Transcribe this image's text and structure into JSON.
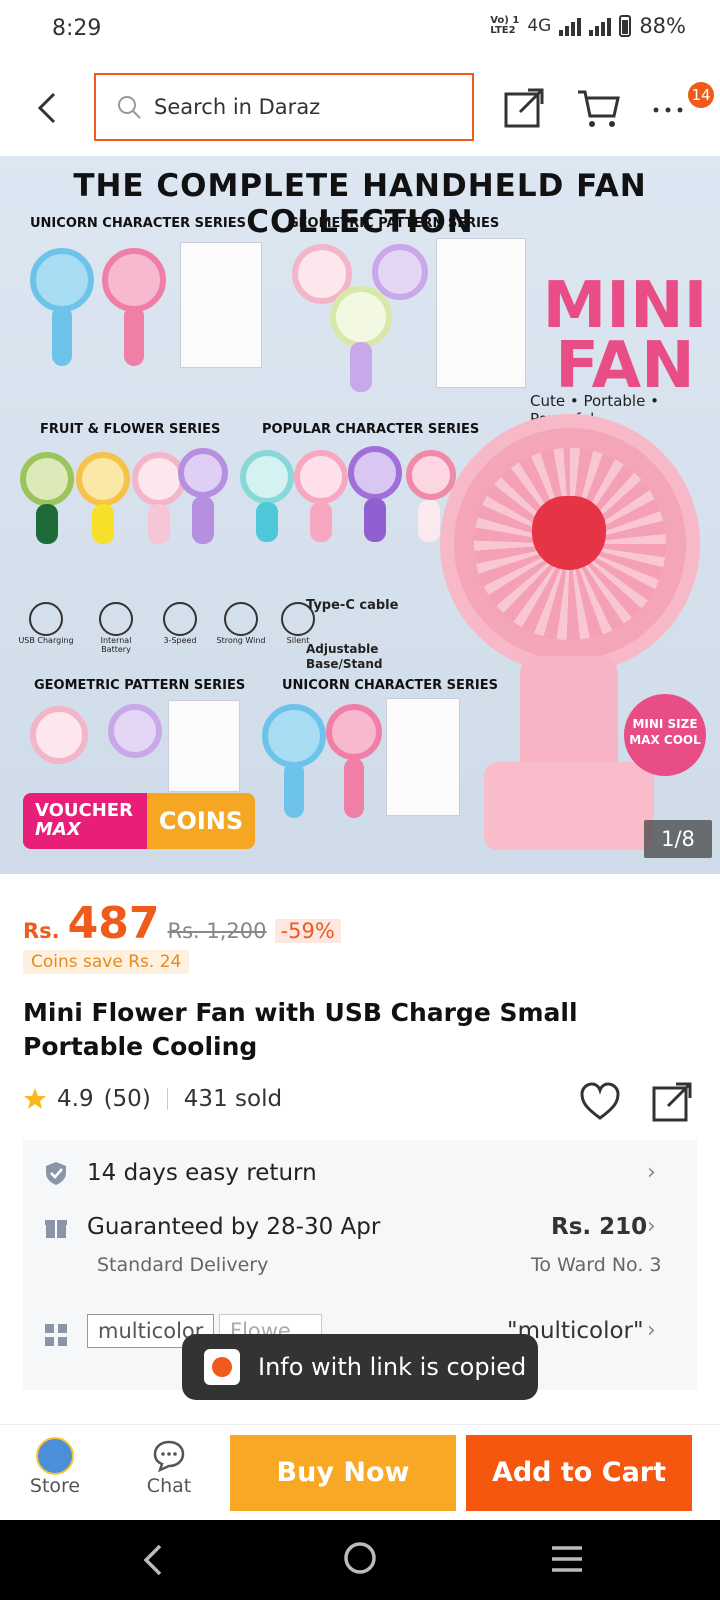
{
  "status_bar": {
    "time": "8:29",
    "network_tag_top": "Vo) 1",
    "network_tag_bottom": "LTE2",
    "network": "4G",
    "battery": "88%"
  },
  "header": {
    "search_placeholder": "Search in Daraz",
    "badge_count": "14"
  },
  "hero": {
    "title": "THE COMPLETE HANDHELD FAN COLLECTION",
    "series": [
      "UNICORN CHARACTER SERIES",
      "GEOMETRIC PATTERN SERIES",
      "FRUIT & FLOWER SERIES",
      "POPULAR CHARACTER SERIES",
      "GEOMETRIC PATTERN SERIES",
      "UNICORN CHARACTER SERIES"
    ],
    "mini_fan_line1": "MINI",
    "mini_fan_line2": "FAN",
    "tagline": "Cute • Portable • Powerful",
    "features": [
      "USB Charging",
      "Internal Battery",
      "3-Speed",
      "Strong Wind",
      "Silent"
    ],
    "type_c": "Type-C cable",
    "adjustable": "Adjustable Base/Stand",
    "mini_size": "MINI SIZE MAX COOL",
    "voucher_line1": "VOUCHER",
    "voucher_line2": "MAX",
    "voucher_coins": "COINS",
    "pager": "1/8"
  },
  "product": {
    "currency": "Rs.",
    "price": "487",
    "old_price": "Rs. 1,200",
    "discount": "-59%",
    "coins_save": "Coins save Rs. 24",
    "name": "Mini Flower Fan with USB Charge Small Portable Cooling",
    "rating": "4.9",
    "reviews": "(50)",
    "sold": "431 sold"
  },
  "info": {
    "return": "14 days easy return",
    "guarantee": "Guaranteed by 28-30 Apr",
    "delivery_type": "Standard Delivery",
    "delivery_fee": "Rs. 210",
    "delivery_to": "To Ward No. 3",
    "variant_chip": "multicolor",
    "variant_chip2": "Flowe...",
    "variant_value": "\"multicolor\""
  },
  "toast": "Info with link is copied",
  "bottom_bar": {
    "store": "Store",
    "chat": "Chat",
    "buy_now": "Buy Now",
    "add_to_cart": "Add to Cart"
  },
  "colors": {
    "accent": "#f05a1a",
    "buy_now": "#f9a825",
    "add_to_cart": "#f5570f",
    "mini_fan": "#e84d86"
  }
}
